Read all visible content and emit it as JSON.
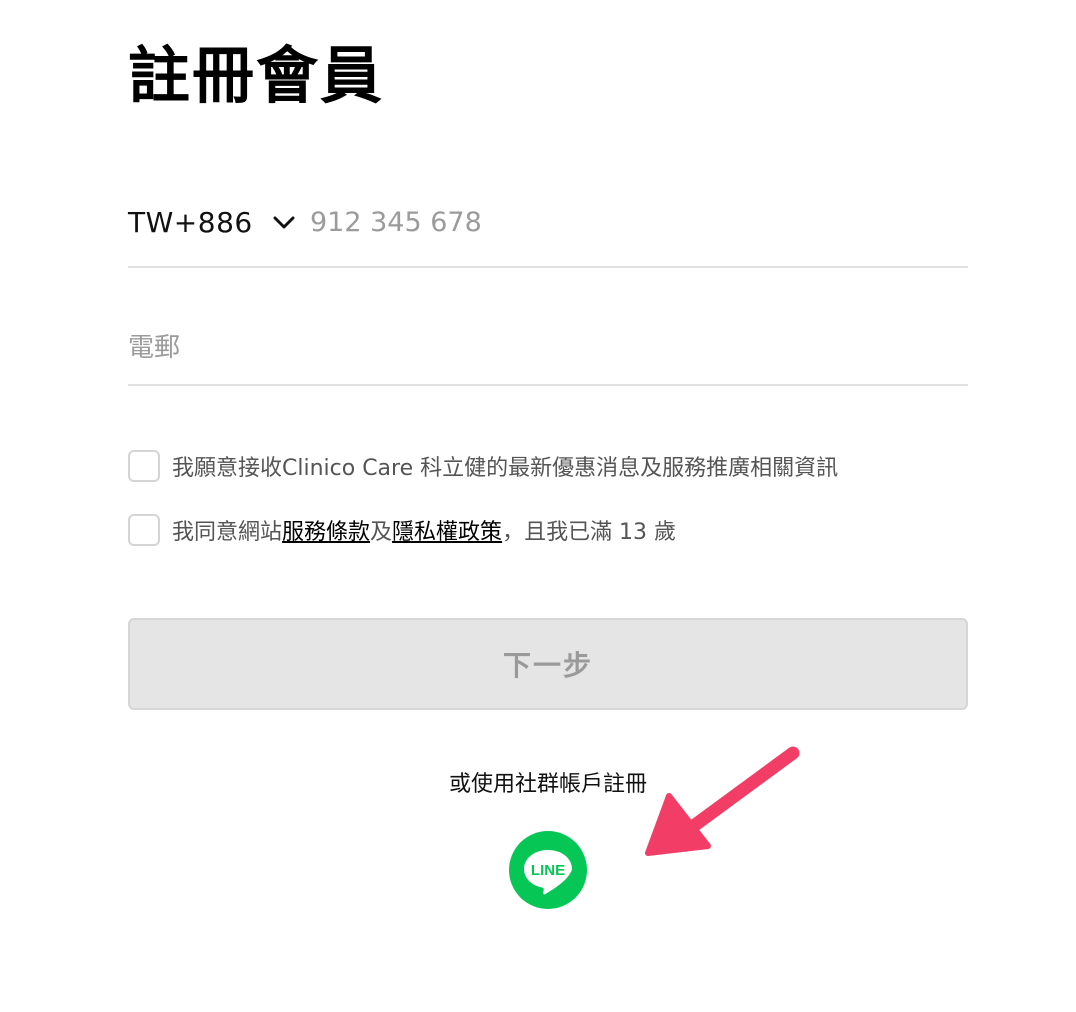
{
  "page": {
    "title": "註冊會員"
  },
  "phone": {
    "country_code": "TW+886",
    "placeholder": "912 345 678",
    "value": ""
  },
  "email": {
    "placeholder": "電郵",
    "value": ""
  },
  "consents": {
    "marketing": {
      "checked": false,
      "label": "我願意接收Clinico Care 科立健的最新優惠消息及服務推廣相關資訊"
    },
    "terms": {
      "checked": false,
      "prefix": "我同意網站",
      "terms_link": "服務條款",
      "and": "及",
      "privacy_link": "隱私權政策",
      "suffix": "，且我已滿 13 歲"
    }
  },
  "next_button": {
    "label": "下一步",
    "disabled": true
  },
  "social": {
    "label": "或使用社群帳戶註冊",
    "line_button_text": "LINE",
    "line_color": "#06C755"
  },
  "annotation": {
    "arrow_color": "#F23E66"
  }
}
